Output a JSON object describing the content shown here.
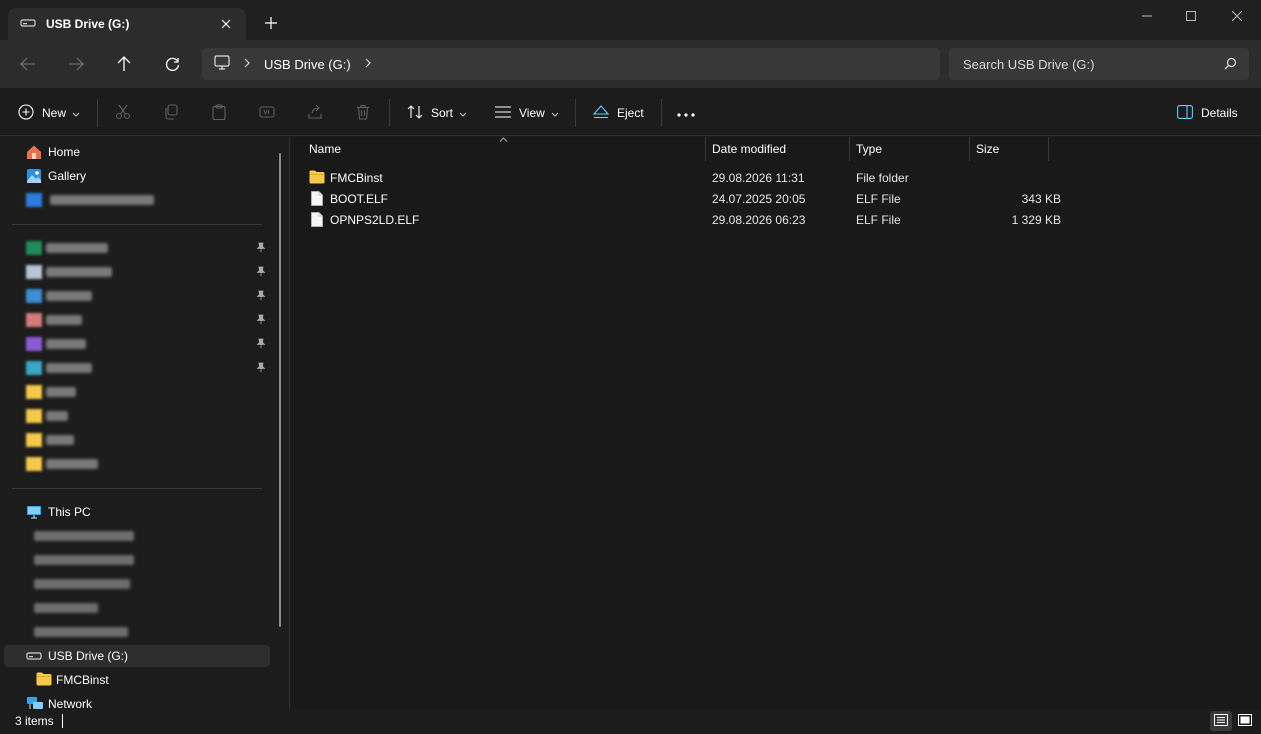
{
  "tab": {
    "title": "USB Drive (G:)"
  },
  "address": {
    "breadcrumb": "USB Drive (G:)"
  },
  "search": {
    "placeholder": "Search USB Drive (G:)"
  },
  "toolbar": {
    "new_label": "New",
    "sort_label": "Sort",
    "view_label": "View",
    "eject_label": "Eject",
    "details_label": "Details"
  },
  "sidebar": {
    "home": "Home",
    "gallery": "Gallery",
    "this_pc": "This PC",
    "usb_drive": "USB Drive (G:)",
    "fmcbinst": "FMCBinst",
    "network": "Network"
  },
  "columns": {
    "name": "Name",
    "date": "Date modified",
    "type": "Type",
    "size": "Size"
  },
  "files": [
    {
      "name": "FMCBinst",
      "date": "29.08.2026 11:31",
      "type": "File folder",
      "size": "",
      "icon": "folder-icon"
    },
    {
      "name": "BOOT.ELF",
      "date": "24.07.2025 20:05",
      "type": "ELF File",
      "size": "343 KB",
      "icon": "file-icon"
    },
    {
      "name": "OPNPS2LD.ELF",
      "date": "29.08.2026 06:23",
      "type": "ELF File",
      "size": "1 329 KB",
      "icon": "file-icon"
    }
  ],
  "status": {
    "items": "3 items"
  },
  "colors": {
    "folder": "#f7c948",
    "accent": "#60cdff",
    "background": "#191919"
  }
}
